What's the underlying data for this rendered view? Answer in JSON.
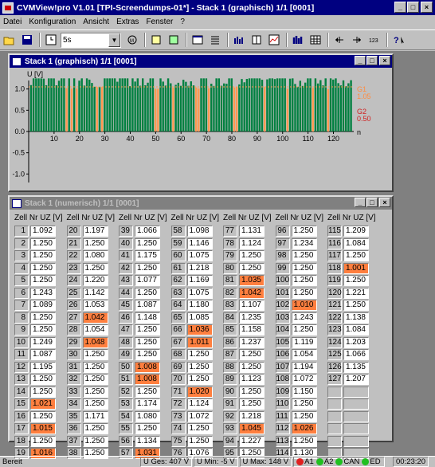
{
  "app": {
    "title": "CVMView!pro  V1.01 [TPI-Screendumps-01*] - Stack 1 (graphisch) 1/1 [0001]"
  },
  "menu": [
    "Datei",
    "Konfiguration",
    "Ansicht",
    "Extras",
    "Fenster",
    "?"
  ],
  "toolbar": {
    "interval_value": "5s"
  },
  "graph_window": {
    "title": "Stack 1 (graphisch) 1/1 [0001]",
    "ylabel": "U [V]",
    "xlabel": "n",
    "y_ticks": [
      "1.0",
      "0.5",
      "0.0",
      "-0.5",
      "-1.0"
    ],
    "x_ticks": [
      "10",
      "20",
      "30",
      "40",
      "50",
      "60",
      "70",
      "80",
      "90",
      "100",
      "110",
      "120"
    ],
    "legend": [
      {
        "name": "G1",
        "value": "1.05",
        "color": "#ff8c40"
      },
      {
        "name": "G2",
        "value": "0.50",
        "color": "#d02020"
      }
    ],
    "bar_color": "#008040",
    "highlight_color": "#ff9a50"
  },
  "chart_data": {
    "type": "bar",
    "ylabel": "U [V]",
    "xlabel": "n",
    "ylim": [
      -1.2,
      1.2
    ],
    "xlim": [
      0,
      128
    ],
    "threshold_G1": 1.05,
    "threshold_G2": 0.5,
    "values": [
      1.092,
      1.25,
      1.25,
      1.25,
      1.25,
      1.243,
      1.089,
      1.25,
      1.25,
      1.249,
      1.087,
      1.195,
      1.25,
      1.25,
      1.021,
      1.25,
      1.015,
      1.25,
      1.016,
      1.197,
      1.25,
      1.08,
      1.25,
      1.22,
      1.142,
      1.053,
      1.042,
      1.054,
      1.048,
      1.25,
      1.25,
      1.25,
      1.25,
      1.25,
      1.171,
      1.25,
      1.25,
      1.25,
      1.25,
      1.066,
      1.25,
      1.175,
      1.25,
      1.077,
      1.25,
      1.087,
      1.148,
      1.25,
      1.25,
      1.008,
      1.008,
      1.25,
      1.174,
      1.08,
      1.25,
      1.134,
      1.031,
      1.098,
      1.146,
      1.075,
      1.218,
      1.169,
      1.075,
      1.18,
      1.085,
      1.036,
      1.011,
      1.25,
      1.25,
      1.25,
      1.02,
      1.124,
      1.072,
      1.25,
      1.25,
      1.076,
      1.131,
      1.124,
      1.25,
      1.25,
      1.035,
      1.042,
      1.107,
      1.235,
      1.158,
      1.237,
      1.25,
      1.25,
      1.25,
      1.25,
      1.25,
      1.218,
      1.045,
      1.227,
      1.25,
      1.25,
      1.234,
      1.25,
      1.25,
      1.25,
      1.25,
      1.01,
      1.243,
      1.25,
      1.119,
      1.054,
      1.194,
      1.072,
      1.15,
      1.25,
      1.25,
      1.026,
      1.25,
      1.13,
      1.209,
      1.084,
      1.25,
      1.001,
      1.25,
      1.221,
      1.25,
      1.138,
      1.084,
      1.203,
      1.066,
      1.135,
      1.207
    ]
  },
  "numeric_window": {
    "title": "Stack 1 (numerisch) 1/1 [0001]",
    "header": "Zell Nr UZ [V]",
    "columns": [
      {
        "cells": [
          [
            1,
            "1.092",
            0
          ],
          [
            2,
            "1.250",
            0
          ],
          [
            3,
            "1.250",
            0
          ],
          [
            4,
            "1.250",
            0
          ],
          [
            5,
            "1.250",
            0
          ],
          [
            6,
            "1.243",
            0
          ],
          [
            7,
            "1.089",
            0
          ],
          [
            8,
            "1.250",
            0
          ],
          [
            9,
            "1.250",
            0
          ],
          [
            10,
            "1.249",
            0
          ],
          [
            11,
            "1.087",
            0
          ],
          [
            12,
            "1.195",
            0
          ],
          [
            13,
            "1.250",
            0
          ],
          [
            14,
            "1.250",
            0
          ],
          [
            15,
            "1.021",
            1
          ],
          [
            16,
            "1.250",
            0
          ],
          [
            17,
            "1.015",
            1
          ],
          [
            18,
            "1.250",
            0
          ],
          [
            19,
            "1.016",
            1
          ]
        ]
      },
      {
        "cells": [
          [
            20,
            "1.197",
            0
          ],
          [
            21,
            "1.250",
            0
          ],
          [
            22,
            "1.080",
            0
          ],
          [
            23,
            "1.250",
            0
          ],
          [
            24,
            "1.220",
            0
          ],
          [
            25,
            "1.142",
            0
          ],
          [
            26,
            "1.053",
            0
          ],
          [
            27,
            "1.042",
            1
          ],
          [
            28,
            "1.054",
            0
          ],
          [
            29,
            "1.048",
            1
          ],
          [
            30,
            "1.250",
            0
          ],
          [
            31,
            "1.250",
            0
          ],
          [
            32,
            "1.250",
            0
          ],
          [
            33,
            "1.250",
            0
          ],
          [
            34,
            "1.250",
            0
          ],
          [
            35,
            "1.171",
            0
          ],
          [
            36,
            "1.250",
            0
          ],
          [
            37,
            "1.250",
            0
          ],
          [
            38,
            "1.250",
            0
          ]
        ]
      },
      {
        "cells": [
          [
            39,
            "1.066",
            0
          ],
          [
            40,
            "1.250",
            0
          ],
          [
            41,
            "1.175",
            0
          ],
          [
            42,
            "1.250",
            0
          ],
          [
            43,
            "1.077",
            0
          ],
          [
            44,
            "1.250",
            0
          ],
          [
            45,
            "1.087",
            0
          ],
          [
            46,
            "1.148",
            0
          ],
          [
            47,
            "1.250",
            0
          ],
          [
            48,
            "1.250",
            0
          ],
          [
            49,
            "1.250",
            0
          ],
          [
            50,
            "1.008",
            1
          ],
          [
            51,
            "1.008",
            1
          ],
          [
            52,
            "1.250",
            0
          ],
          [
            53,
            "1.174",
            0
          ],
          [
            54,
            "1.080",
            0
          ],
          [
            55,
            "1.250",
            0
          ],
          [
            56,
            "1.134",
            0
          ],
          [
            57,
            "1.031",
            1
          ]
        ]
      },
      {
        "cells": [
          [
            58,
            "1.098",
            0
          ],
          [
            59,
            "1.146",
            0
          ],
          [
            60,
            "1.075",
            0
          ],
          [
            61,
            "1.218",
            0
          ],
          [
            62,
            "1.169",
            0
          ],
          [
            63,
            "1.075",
            0
          ],
          [
            64,
            "1.180",
            0
          ],
          [
            65,
            "1.085",
            0
          ],
          [
            66,
            "1.036",
            1
          ],
          [
            67,
            "1.011",
            1
          ],
          [
            68,
            "1.250",
            0
          ],
          [
            69,
            "1.250",
            0
          ],
          [
            70,
            "1.250",
            0
          ],
          [
            71,
            "1.020",
            1
          ],
          [
            72,
            "1.124",
            0
          ],
          [
            73,
            "1.072",
            0
          ],
          [
            74,
            "1.250",
            0
          ],
          [
            75,
            "1.250",
            0
          ],
          [
            76,
            "1.076",
            0
          ]
        ]
      },
      {
        "cells": [
          [
            77,
            "1.131",
            0
          ],
          [
            78,
            "1.124",
            0
          ],
          [
            79,
            "1.250",
            0
          ],
          [
            80,
            "1.250",
            0
          ],
          [
            81,
            "1.035",
            1
          ],
          [
            82,
            "1.042",
            1
          ],
          [
            83,
            "1.107",
            0
          ],
          [
            84,
            "1.235",
            0
          ],
          [
            85,
            "1.158",
            0
          ],
          [
            86,
            "1.237",
            0
          ],
          [
            87,
            "1.250",
            0
          ],
          [
            88,
            "1.250",
            0
          ],
          [
            89,
            "1.123",
            0
          ],
          [
            90,
            "1.250",
            0
          ],
          [
            91,
            "1.250",
            0
          ],
          [
            92,
            "1.218",
            0
          ],
          [
            93,
            "1.045",
            1
          ],
          [
            94,
            "1.227",
            0
          ],
          [
            95,
            "1.250",
            0
          ]
        ]
      },
      {
        "cells": [
          [
            96,
            "1.250",
            0
          ],
          [
            97,
            "1.234",
            0
          ],
          [
            98,
            "1.250",
            0
          ],
          [
            99,
            "1.250",
            0
          ],
          [
            100,
            "1.250",
            0
          ],
          [
            101,
            "1.250",
            0
          ],
          [
            102,
            "1.010",
            1
          ],
          [
            103,
            "1.243",
            0
          ],
          [
            104,
            "1.250",
            0
          ],
          [
            105,
            "1.119",
            0
          ],
          [
            106,
            "1.054",
            0
          ],
          [
            107,
            "1.194",
            0
          ],
          [
            108,
            "1.072",
            0
          ],
          [
            109,
            "1.150",
            0
          ],
          [
            110,
            "1.250",
            0
          ],
          [
            111,
            "1.250",
            0
          ],
          [
            112,
            "1.026",
            1
          ],
          [
            113,
            "1.250",
            0
          ],
          [
            114,
            "1.130",
            0
          ]
        ]
      },
      {
        "cells": [
          [
            115,
            "1.209",
            0
          ],
          [
            116,
            "1.084",
            0
          ],
          [
            117,
            "1.250",
            0
          ],
          [
            118,
            "1.001",
            1
          ],
          [
            119,
            "1.250",
            0
          ],
          [
            120,
            "1.221",
            0
          ],
          [
            121,
            "1.250",
            0
          ],
          [
            122,
            "1.138",
            0
          ],
          [
            123,
            "1.084",
            0
          ],
          [
            124,
            "1.203",
            0
          ],
          [
            125,
            "1.066",
            0
          ],
          [
            126,
            "1.135",
            0
          ],
          [
            127,
            "1.207",
            0
          ],
          [
            "",
            "",
            2
          ],
          [
            "",
            "",
            2
          ],
          [
            "",
            "",
            2
          ],
          [
            "",
            "",
            2
          ],
          [
            "",
            "",
            2
          ],
          [
            "",
            "",
            2
          ]
        ]
      }
    ]
  },
  "status": {
    "ready": "Bereit",
    "u_ges": "U Ges:  407 V",
    "u_min": "U Min:  -5 V",
    "u_max": "U Max:  148 V",
    "leds": "A1  A2  CAN  ED",
    "time": "00:23:20"
  }
}
